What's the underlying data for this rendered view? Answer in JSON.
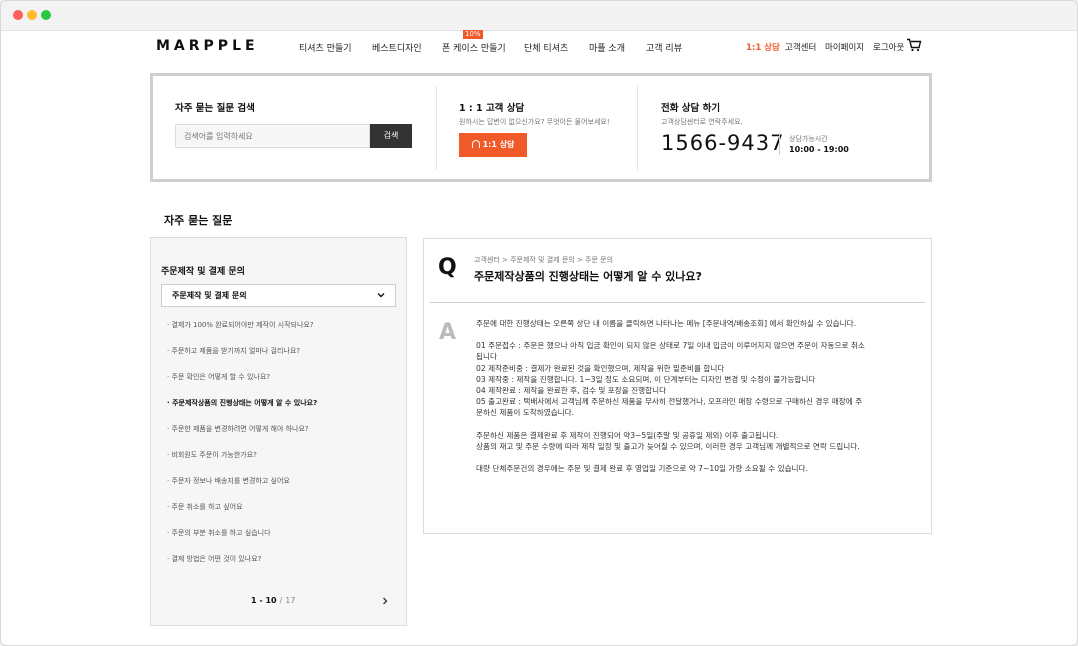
{
  "header": {
    "logo": "MARPPLE",
    "nav": [
      "티셔츠 만들기",
      "베스트디자인",
      "폰 케이스 만들기",
      "단체 티셔츠",
      "마플 소개",
      "고객 리뷰"
    ],
    "nav_badge": "10%",
    "util": [
      "1:1 상담",
      "고객센터",
      "마이페이지",
      "로그아웃"
    ],
    "accent_color": "#f05a28"
  },
  "search_section": {
    "title": "자주 묻는 질문 검색",
    "placeholder": "검색어를 입력하세요",
    "button": "검색"
  },
  "chat_section": {
    "title": "1 : 1 고객 상담",
    "subtitle": "원하시는 답변이 없으신가요? 무엇이든 물어보세요!",
    "button": "1:1 상담"
  },
  "phone_section": {
    "title": "전화 상담 하기",
    "subtitle": "고객상담센터로 연락주세요.",
    "number": "1566-9437",
    "hours_label": "상담가능시간",
    "hours": "10:00 - 19:00"
  },
  "faq": {
    "heading": "자주 묻는 질문",
    "category_title": "주문제작 및 결제 문의",
    "category_selected": "주문제작 및 결제 문의",
    "items": [
      "· 결제가 100% 완료되어야만 제작이 시작되나요?",
      "· 주문하고 제품을 받기까지 얼마나 걸리나요?",
      "· 주문 확인은 어떻게 할 수 있나요?",
      "· 주문제작상품의 진행상태는 어떻게 알 수 있나요?",
      "· 주문한 제품을 변경하려면 어떻게 해야 하나요?",
      "· 비회원도 주문이 가능한가요?",
      "· 주문자 정보나 배송지를 변경하고 싶어요",
      "· 주문 취소를 하고 싶어요",
      "· 주문의 부분 취소를 하고 싶습니다",
      "· 결제 방법은 어떤 것이 있나요?"
    ],
    "active_index": 3,
    "pager": {
      "range": "1 - 10",
      "sep": "/",
      "total": "17"
    }
  },
  "answer": {
    "q_letter": "Q",
    "a_letter": "A",
    "breadcrumb": "고객센터 > 주문제작 및 결제 문의 > 주문 문의",
    "question": "주문제작상품의 진행상태는 어떻게 알 수 있나요?",
    "body": [
      "주문에 대한 진행상태는 오른쪽 상단 내 이름을 클릭하면 나타나는 메뉴 [주문내역/배송조회] 에서 확인하실 수 있습니다.",
      "",
      "01 주문접수 : 주문은 했으나 아직 입금 확인이 되지 않은 상태로 7일 이내 입금이 이루어지지 않으면 주문이 자동으로 취소",
      "됩니다",
      "02 제작준비중 : 결제가 완료된 것을 확인했으며, 제작을 위한 밑준비를 합니다",
      "03 제작중 : 제작을 진행합니다. 1~3일 정도 소요되며, 이 단계부터는 디자인 변경 및 수정이 불가능합니다",
      "04 제작완료 : 제작을 완료한 후, 검수 및 포장을 진행합니다",
      "05 출고완료 : 택배사에서 고객님께 주문하신 제품을 무사히 전달했거나, 오프라인 매장 수령으로 구매하신 경우 매장에 주",
      "문하신 제품이 도착하였습니다.",
      "",
      "주문하신 제품은 결제완료 후 제작이 진행되어 약3~5일(주말 및 공휴일 제외) 이후 출고됩니다.",
      "상품의 재고 및 주문 수량에 따라 제작 일정 및 출고가 늦어질 수 있으며, 이러한 경우 고객님께 개별적으로 연락 드립니다.",
      "",
      "대량 단체주문건의 경우에는 주문 및 결제 완료 후 영업일 기준으로 약 7~10일 가량 소요될 수 있습니다."
    ]
  }
}
